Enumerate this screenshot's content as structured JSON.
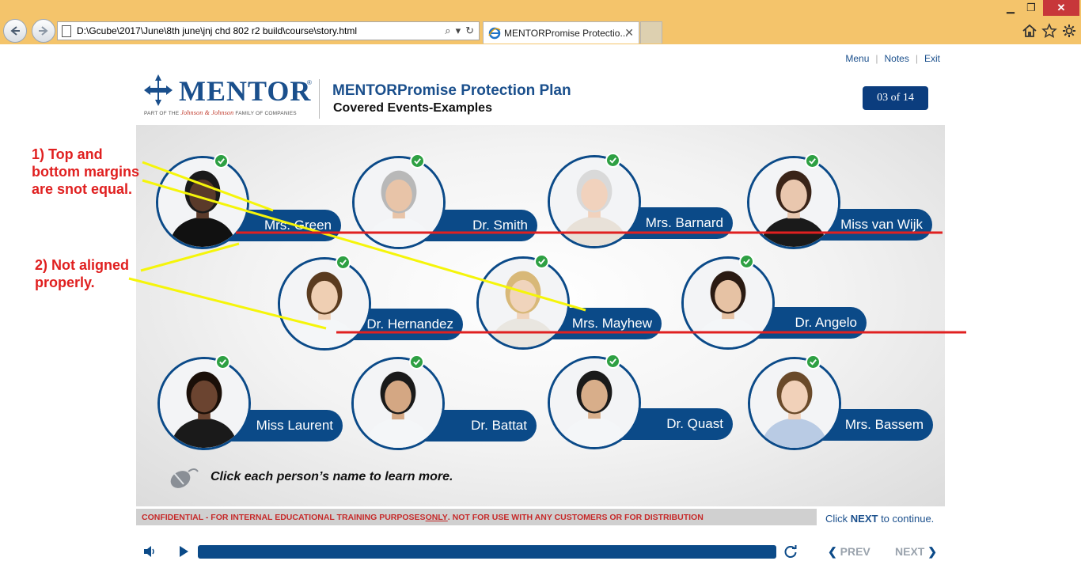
{
  "browser": {
    "address": "D:\\Gcube\\2017\\June\\8th june\\jnj chd 802 r2 build\\course\\story.html",
    "tab_title": "MENTORPromise Protectio...",
    "tab_close": "✕"
  },
  "topmenu": {
    "menu": "Menu",
    "notes": "Notes",
    "exit": "Exit"
  },
  "logo": {
    "word": "MENTOR",
    "reg": "®",
    "tag_prefix": "PART OF THE ",
    "tag_brand": "Johnson & Johnson",
    "tag_suffix": " FAMILY OF COMPANIES"
  },
  "header": {
    "title": "MENTORPromise Protection Plan",
    "subtitle": "Covered Events-Examples",
    "page_count": "03 of 14"
  },
  "people": [
    {
      "name": "Mrs. Green",
      "visited": true
    },
    {
      "name": "Dr. Smith",
      "visited": true
    },
    {
      "name": "Mrs. Barnard",
      "visited": true
    },
    {
      "name": "Miss van Wijk",
      "visited": true
    },
    {
      "name": "Dr. Hernandez",
      "visited": true
    },
    {
      "name": "Mrs. Mayhew",
      "visited": true
    },
    {
      "name": "Dr. Angelo",
      "visited": true
    },
    {
      "name": "Miss Laurent",
      "visited": true
    },
    {
      "name": "Dr. Battat",
      "visited": true
    },
    {
      "name": "Dr. Quast",
      "visited": true
    },
    {
      "name": "Mrs. Bassem",
      "visited": true
    }
  ],
  "hint": "Click each person’s name to learn more.",
  "confidential": {
    "prefix": "CONFIDENTIAL - FOR INTERNAL EDUCATIONAL TRAINING PURPOSES ",
    "only": "ONLY",
    "suffix": ". NOT FOR USE WITH ANY CUSTOMERS OR FOR DISTRIBUTION"
  },
  "continue": {
    "prefix": "Click ",
    "next": "NEXT",
    "suffix": " to continue."
  },
  "player": {
    "prev": "PREV",
    "next": "NEXT",
    "progress": 1.0
  },
  "annotations": {
    "note1": "1) Top and\nbottom margins\nare snot equal.",
    "note2": "2) Not aligned\nproperly."
  },
  "colors": {
    "brand": "#0b4a88",
    "check": "#2ea043",
    "annotation_red": "#e02020",
    "annotation_yellow": "#f5f50a",
    "chrome": "#f4c46b"
  }
}
